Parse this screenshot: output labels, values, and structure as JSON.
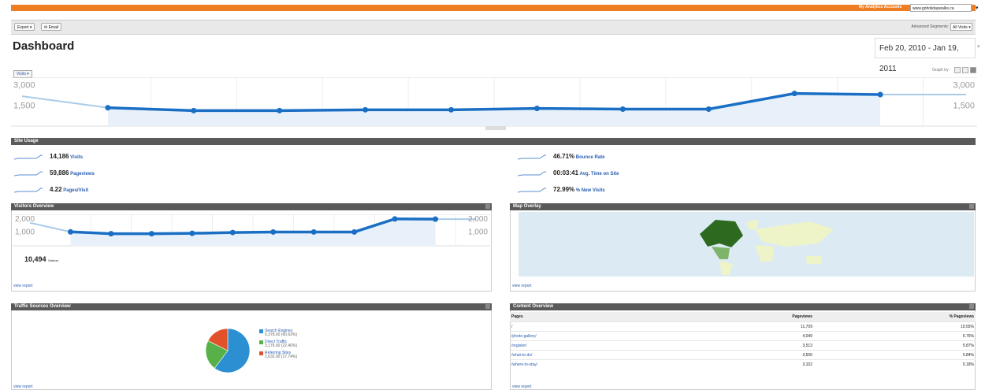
{
  "header": {
    "account_name": "My Analytics Accounts",
    "account_value": "www.goholidaywalks.ca"
  },
  "toolbar": {
    "export_label": "Export ▾",
    "email_label": "✉ Email",
    "advanced_segments_label": "Advanced Segments:",
    "segment_value": "All Visits ▾"
  },
  "page": {
    "title": "Dashboard",
    "date_range": "Feb 20, 2010 - Jan 19, 2011"
  },
  "main_chart": {
    "metric_label": "Visits ▾",
    "graph_by_label": "Graph by:",
    "y_ticks": [
      "3,000",
      "1,500"
    ]
  },
  "site_usage": {
    "title": "Site Usage",
    "stats_left": [
      {
        "value": "14,186",
        "label": "Visits"
      },
      {
        "value": "59,886",
        "label": "Pageviews"
      },
      {
        "value": "4.22",
        "label": "Pages/Visit"
      }
    ],
    "stats_right": [
      {
        "value": "46.71%",
        "label": "Bounce Rate"
      },
      {
        "value": "00:03:41",
        "label": "Avg. Time on Site"
      },
      {
        "value": "72.99%",
        "label": "% New Visits"
      }
    ]
  },
  "visitors_overview": {
    "title": "Visitors Overview",
    "y_ticks": [
      "2,000",
      "1,000"
    ],
    "total": "10,494",
    "total_label": "Visitors",
    "view_report": "view report"
  },
  "map_overlay": {
    "title": "Map Overlay",
    "view_report": "view report"
  },
  "traffic_sources": {
    "title": "Traffic Sources Overview",
    "view_report": "view report",
    "legend": [
      {
        "name": "Search Engines",
        "sub": "6,378.00 (60.63%)",
        "color": "#2b8fd1"
      },
      {
        "name": "Direct Traffic",
        "sub": "3,176.00 (22.40%)",
        "color": "#57b148"
      },
      {
        "name": "Referring Sites",
        "sub": "2,632.00 (17.74%)",
        "color": "#e2522a"
      }
    ]
  },
  "content_overview": {
    "title": "Content Overview",
    "view_report": "view report",
    "columns": [
      "Pages",
      "Pageviews",
      "% Pageviews"
    ],
    "rows": [
      [
        "/",
        "11,709",
        "19.55%"
      ],
      [
        "/photo-gallery/",
        "4,049",
        "6.76%"
      ],
      [
        "/register/",
        "3,513",
        "5.87%"
      ],
      [
        "/what-to-do/",
        "3,500",
        "5.84%"
      ],
      [
        "/where-to-stay/",
        "3,102",
        "5.18%"
      ]
    ]
  },
  "chart_data": [
    {
      "type": "line",
      "name": "main",
      "values": [
        2200,
        1350,
        1140,
        1140,
        1200,
        1200,
        1300,
        1250,
        1250,
        2400,
        2320,
        2320
      ],
      "ylim": [
        0,
        3600
      ]
    },
    {
      "type": "line",
      "name": "visitors",
      "values": [
        1900,
        1150,
        1000,
        1000,
        1030,
        1100,
        1140,
        1140,
        1140,
        2220,
        2200,
        2200
      ],
      "ylim": [
        0,
        2600
      ]
    },
    {
      "type": "pie",
      "values": [
        60.63,
        22.4,
        17.74
      ]
    }
  ]
}
